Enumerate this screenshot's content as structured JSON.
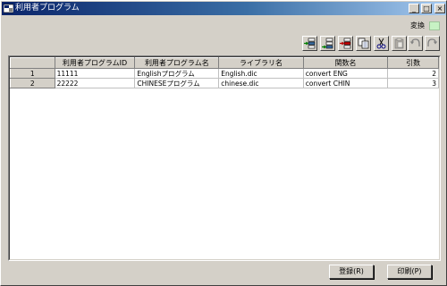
{
  "window": {
    "title": "利用者プログラム"
  },
  "titlebar": {
    "minimize": "_",
    "maximize": "□",
    "close": "×"
  },
  "henkan": {
    "label": "変換",
    "swatch_color": "#c7f2c4"
  },
  "toolbar": {
    "buttons": [
      {
        "icon": "insert-row-icon"
      },
      {
        "icon": "append-row-icon"
      },
      {
        "icon": "delete-row-icon"
      },
      {
        "icon": "copy-icon"
      },
      {
        "icon": "cut-icon"
      },
      {
        "icon": "paste-icon"
      },
      {
        "icon": "undo-icon"
      },
      {
        "icon": "redo-icon"
      }
    ]
  },
  "table": {
    "columns": [
      "",
      "利用者プログラムID",
      "利用者プログラム名",
      "ライブラリ名",
      "関数名",
      "引数"
    ],
    "rows": [
      {
        "num": "1",
        "id": "11111",
        "name": "Englishプログラム",
        "library": "English.dic",
        "function": "convert ENG",
        "args": "2"
      },
      {
        "num": "2",
        "id": "22222",
        "name": "CHINESEプログラム",
        "library": "chinese.dic",
        "function": "convert CHIN",
        "args": "3"
      }
    ]
  },
  "footer": {
    "register_label": "登録(R)",
    "print_label": "印刷(P)"
  }
}
